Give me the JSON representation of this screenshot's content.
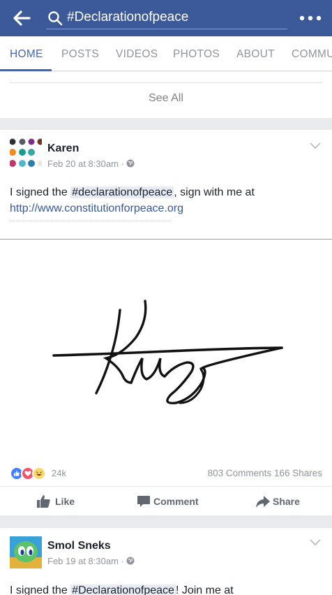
{
  "header": {
    "search_value": "#Declarationofpeace",
    "bar_color": "#3b5998"
  },
  "tabs": [
    {
      "label": "HOME",
      "active": true
    },
    {
      "label": "POSTS",
      "active": false
    },
    {
      "label": "VIDEOS",
      "active": false
    },
    {
      "label": "PHOTOS",
      "active": false
    },
    {
      "label": "ABOUT",
      "active": false
    },
    {
      "label": "COMMU",
      "active": false
    }
  ],
  "see_all": "See All",
  "posts": [
    {
      "author": "Karen",
      "time": "Feb 20 at 8:30am",
      "privacy_icon": "globe-icon",
      "text_before": "I signed the ",
      "hashtag": "#declarationofpeace",
      "text_after": ", sign with me at",
      "link": "http://www.constitutionforpeace.org",
      "image": "handwritten-signature",
      "reaction_count": "24k",
      "comments": "803 Comments",
      "shares": "166 Shares",
      "actions": [
        "Like",
        "Comment",
        "Share"
      ]
    },
    {
      "author": "Smol Sneks",
      "time": "Feb 19 at 8:30am",
      "privacy_icon": "globe-icon",
      "text_before": "I signed the ",
      "hashtag": "#Declarationofpeace",
      "text_after": "! Join me at"
    }
  ]
}
